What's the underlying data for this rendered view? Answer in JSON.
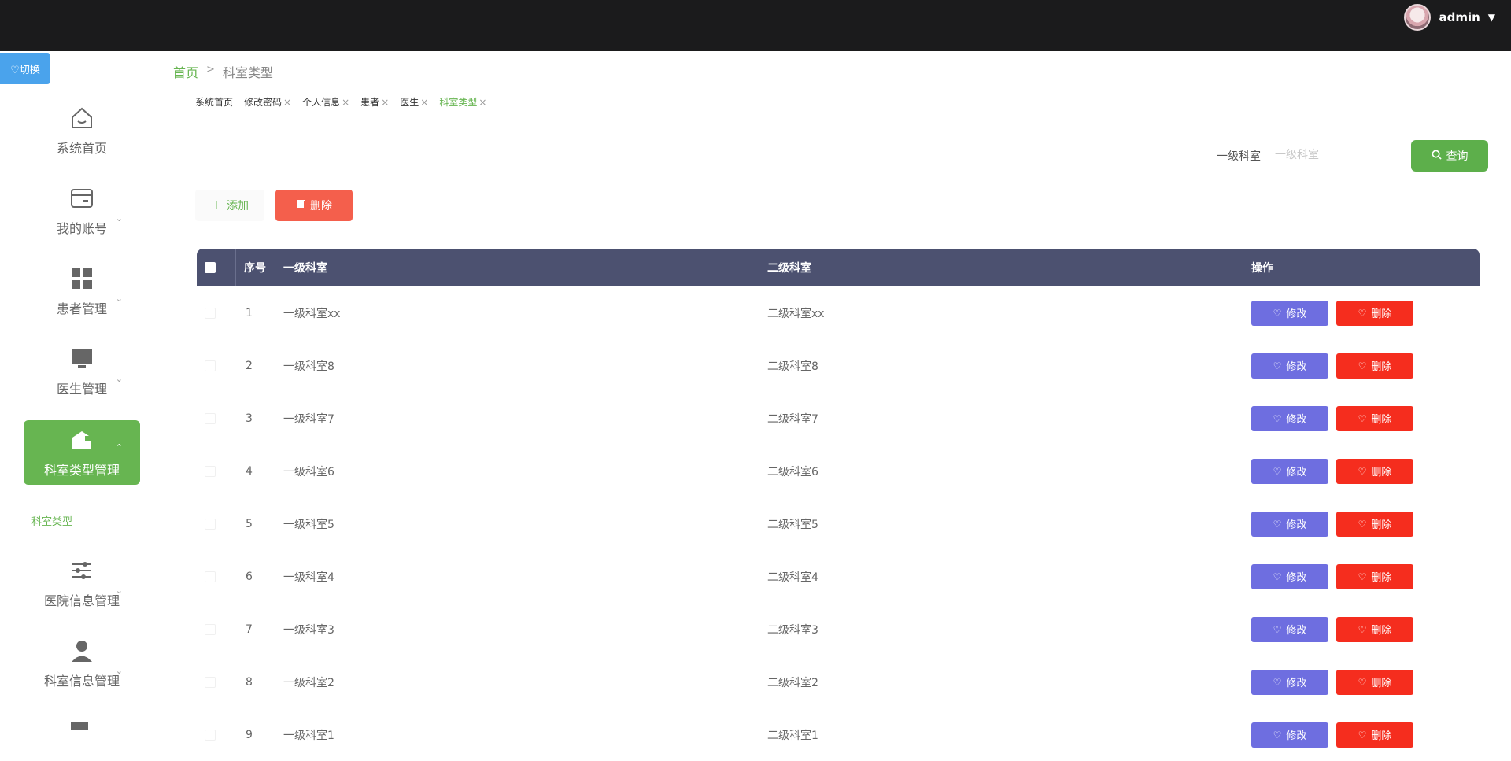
{
  "header": {
    "username": "admin",
    "dropdown_icon": "caret-down-icon"
  },
  "sidebar": {
    "switch_label": "♡切换",
    "items": [
      {
        "label": "系统首页",
        "icon": "home-icon"
      },
      {
        "label": "我的账号",
        "icon": "account-card-icon"
      },
      {
        "label": "患者管理",
        "icon": "grid-icon"
      },
      {
        "label": "医生管理",
        "icon": "monitor-icon"
      },
      {
        "label": "科室类型管理",
        "icon": "department-icon"
      },
      {
        "label": "医院信息管理",
        "icon": "sliders-icon"
      },
      {
        "label": "科室信息管理",
        "icon": "user-icon"
      }
    ],
    "active_sub": "科室类型"
  },
  "breadcrumb": {
    "home": "首页",
    "separator": ">",
    "current": "科室类型"
  },
  "tags": [
    "系统首页",
    "修改密码",
    "个人信息",
    "患者",
    "医生",
    "科室类型"
  ],
  "search": {
    "label": "一级科室",
    "placeholder": "一级科室",
    "button": "查询"
  },
  "actions": {
    "add": "添加",
    "delete": "删除"
  },
  "table": {
    "headers": [
      "序号",
      "一级科室",
      "二级科室",
      "操作"
    ],
    "rows": [
      {
        "idx": "1",
        "l1": "一级科室xx",
        "l2": "二级科室xx"
      },
      {
        "idx": "2",
        "l1": "一级科室8",
        "l2": "二级科室8"
      },
      {
        "idx": "3",
        "l1": "一级科室7",
        "l2": "二级科室7"
      },
      {
        "idx": "4",
        "l1": "一级科室6",
        "l2": "二级科室6"
      },
      {
        "idx": "5",
        "l1": "一级科室5",
        "l2": "二级科室5"
      },
      {
        "idx": "6",
        "l1": "一级科室4",
        "l2": "二级科室4"
      },
      {
        "idx": "7",
        "l1": "一级科室3",
        "l2": "二级科室3"
      },
      {
        "idx": "8",
        "l1": "一级科室2",
        "l2": "二级科室2"
      },
      {
        "idx": "9",
        "l1": "一级科室1",
        "l2": "二级科室1"
      }
    ],
    "edit_label": "修改",
    "delete_label": "删除"
  },
  "colors": {
    "accent": "#67b551",
    "header_bg": "#1b1b1c",
    "table_head": "#4c5170",
    "edit": "#6e6ee0",
    "danger": "#f52d1e"
  }
}
